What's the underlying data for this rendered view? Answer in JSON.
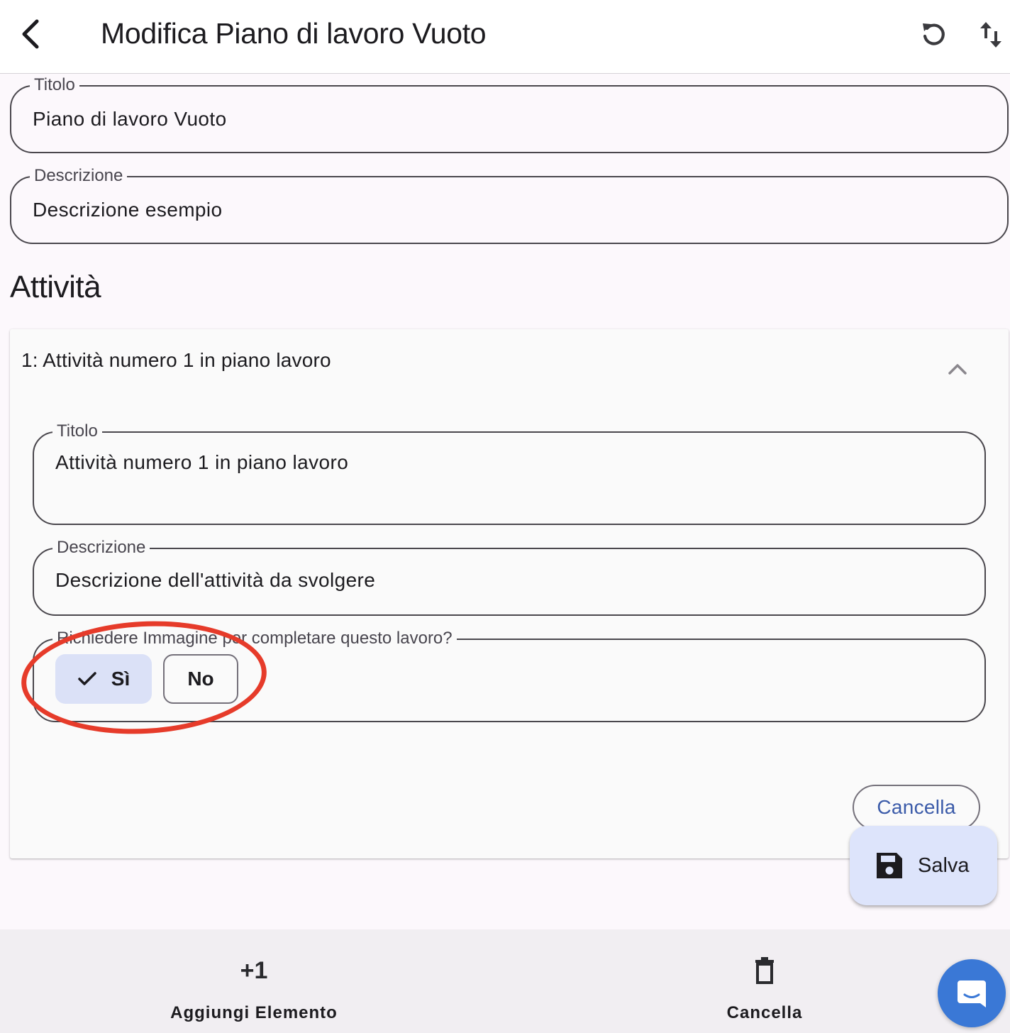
{
  "appbar": {
    "title": "Modifica Piano di lavoro Vuoto",
    "back_icon": "chevron-left-icon",
    "refresh_icon": "refresh-icon",
    "sort_icon": "swap-vert-icon"
  },
  "plan": {
    "title_label": "Titolo",
    "title_value": "Piano di lavoro Vuoto",
    "description_label": "Descrizione",
    "description_value": "Descrizione esempio"
  },
  "activities": {
    "section_title": "Attività",
    "items": [
      {
        "header": "1: Attività numero 1 in piano lavoro",
        "title_label": "Titolo",
        "title_value": "Attività numero 1 in piano lavoro",
        "description_label": "Descrizione",
        "description_value": "Descrizione dell'attività da svolgere",
        "require_image_label": "Richiedere Immagine per completare questo lavoro?",
        "option_yes": "Sì",
        "option_no": "No",
        "selected": "Sì",
        "cancel_label": "Cancella"
      }
    ]
  },
  "fab": {
    "save_label": "Salva",
    "icon": "save-icon"
  },
  "bottom_bar": {
    "add_icon_text": "+1",
    "add_label": "Aggiungi Elemento",
    "delete_label": "Cancella"
  },
  "colors": {
    "accent": "#3b5ba9",
    "selected_bg": "#dbe1f7",
    "fab_bg": "#dde4fb",
    "annotation": "#e63b2a",
    "chat": "#3a78d6"
  }
}
